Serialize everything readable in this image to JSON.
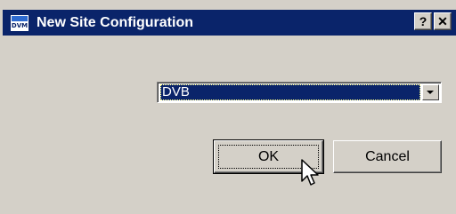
{
  "window": {
    "title": "New Site Configuration",
    "icon_label": "DVM",
    "help_label": "?",
    "close_label": "✕"
  },
  "select": {
    "value": "DVB"
  },
  "buttons": {
    "ok_label": "OK",
    "cancel_label": "Cancel"
  },
  "colors": {
    "title_bar": "#0a246a",
    "dialog_face": "#d4d0c8",
    "selection": "#0a246a"
  }
}
